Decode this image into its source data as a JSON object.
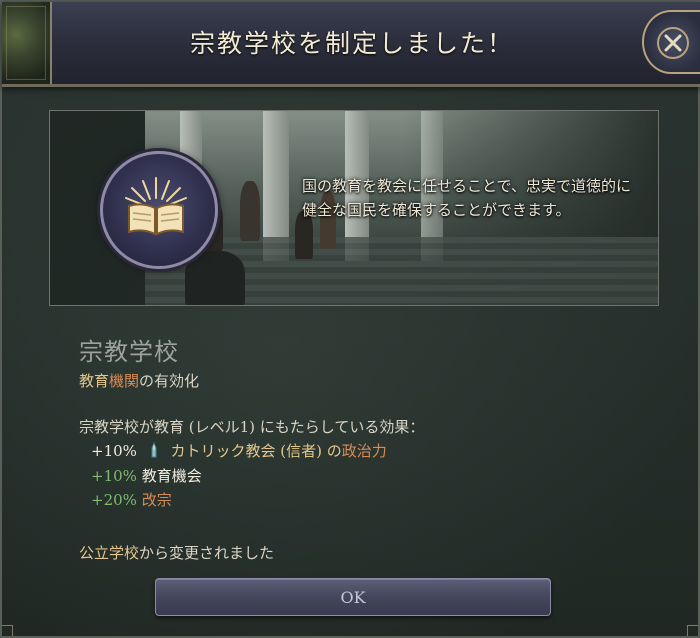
{
  "dialog": {
    "title": "宗教学校を制定しました！",
    "close_icon": "close-icon"
  },
  "art": {
    "emblem_icon": "open-book-icon",
    "description": "国の教育を教会に任せることで、忠実で道徳的に健全な国民を確保することができます。"
  },
  "law": {
    "name": "宗教学校",
    "subtitle_part1": "教育",
    "subtitle_part2": "機関",
    "subtitle_part3": "の有効化"
  },
  "effects": {
    "header": "宗教学校が教育 (レベル1) にもたらしている効果：",
    "items": [
      {
        "value": "+10%",
        "icon": "church-icon",
        "label_a": "カトリック教会 (信者) の",
        "label_b": "政治力"
      },
      {
        "value": "+10%",
        "label": "教育機会"
      },
      {
        "value": "+20%",
        "label": "改宗"
      }
    ]
  },
  "footer": {
    "changed_from_a": "公立学校",
    "changed_from_b": "から変更されました"
  },
  "buttons": {
    "ok_label": "OK"
  },
  "colors": {
    "gold": "#e3c78c",
    "orange": "#d98b54",
    "green": "#7dbd6c",
    "panel": "#262f2b"
  }
}
